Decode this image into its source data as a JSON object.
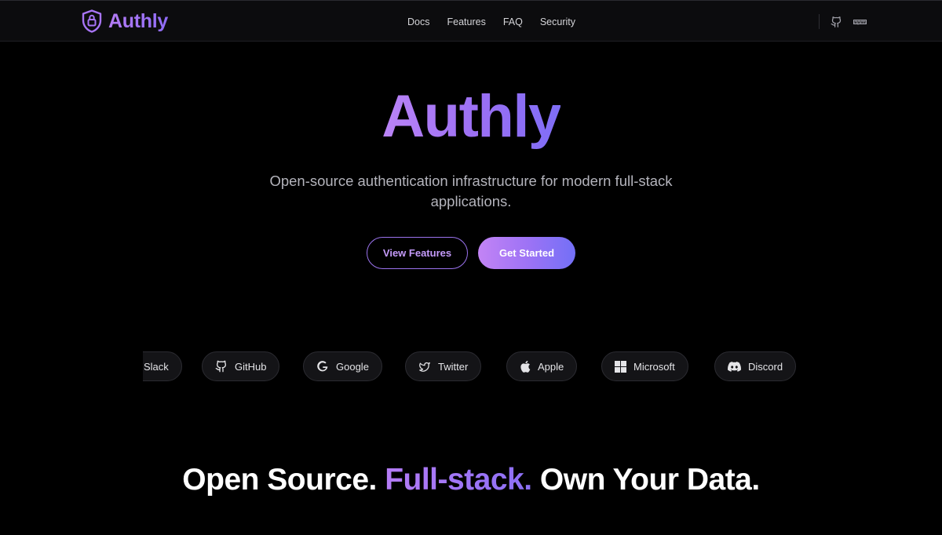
{
  "brand": {
    "name": "Authly",
    "color": "#a875f6"
  },
  "nav": {
    "links": [
      "Docs",
      "Features",
      "FAQ",
      "Security"
    ],
    "icons": [
      "github-icon",
      "npm-icon"
    ]
  },
  "hero": {
    "title": "Authly",
    "subtitle": "Open-source authentication infrastructure for modern full-stack applications.",
    "primary_button": "Get Started",
    "secondary_button": "View Features"
  },
  "providers": [
    "Slack",
    "GitHub",
    "Google",
    "Twitter",
    "Apple",
    "Microsoft",
    "Discord"
  ],
  "tagline": {
    "part1": "Open Source.",
    "part2": "Full-stack.",
    "part3": "Own Your Data."
  },
  "colors": {
    "background": "#000000",
    "accent_start": "#bb84f7",
    "accent_end": "#7370f6"
  }
}
